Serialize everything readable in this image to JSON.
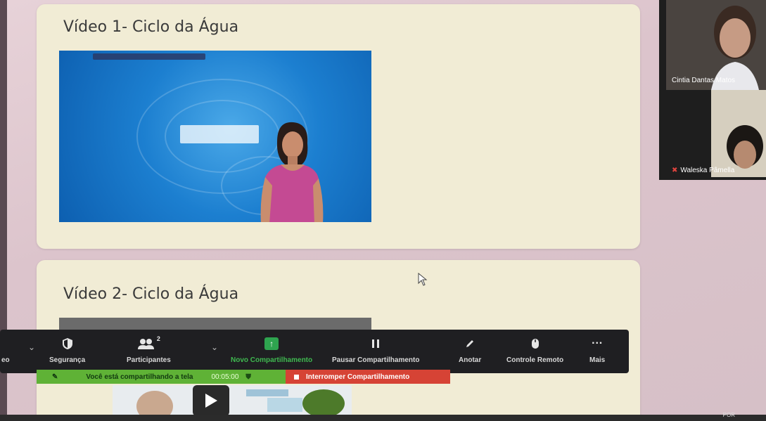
{
  "content": {
    "video1_title": "Vídeo 1- Ciclo da Água",
    "video2_title": "Vídeo 2- Ciclo da Água"
  },
  "participants_panel": {
    "tile1_name": "Cintia Dantas Matos",
    "tile2_name": "Waleska Pâmella"
  },
  "toolbar": {
    "left_cut": "eo",
    "security": "Segurança",
    "participants": "Participantes",
    "participants_count": "2",
    "new_share": "Novo Compartilhamento",
    "pause_share": "Pausar Compartilhamento",
    "annotate": "Anotar",
    "remote_control": "Controle Remoto",
    "more": "Mais"
  },
  "share_status": {
    "message": "Você está compartilhando a tela",
    "timer": "00:05:00",
    "stop": "Interromper Compartilhamento"
  },
  "taskbar": {
    "lang": "POR"
  },
  "icons": [
    "shield-icon",
    "participants-icon",
    "chevron-down-icon",
    "share-up-arrow-icon",
    "pause-icon",
    "pencil-icon",
    "remote-mouse-icon",
    "more-dots-icon",
    "play-icon",
    "mic-muted-icon",
    "cursor-icon"
  ],
  "colors": {
    "share_green": "#5fb236",
    "stop_red": "#d64335",
    "new_share_green": "#2ea44f",
    "card_bg": "#f1ecd5"
  }
}
